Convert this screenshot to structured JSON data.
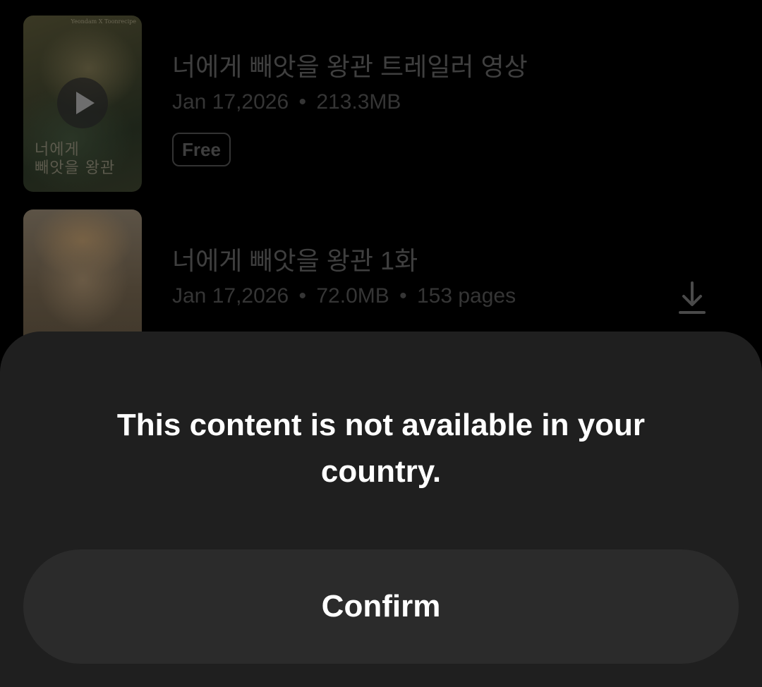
{
  "episodes": [
    {
      "title": "너에게 빼앗을 왕관 트레일러 영상",
      "date": "Jan 17,2026",
      "separator": "•",
      "size": "213.3MB",
      "badge": "Free",
      "thumbnail_title": "너에게\n빼앗을 왕관",
      "thumbnail_publisher": "Yeondam X Toonrecipe",
      "play_icon": "play-icon"
    },
    {
      "title": "너에게 빼앗을 왕관 1화",
      "date": "Jan 17,2026",
      "separator": "•",
      "size": "72.0MB",
      "pages": "153 pages",
      "action_icon": "download-icon"
    }
  ],
  "dialog": {
    "message": "This content is not available in your country.",
    "confirm_label": "Confirm"
  }
}
